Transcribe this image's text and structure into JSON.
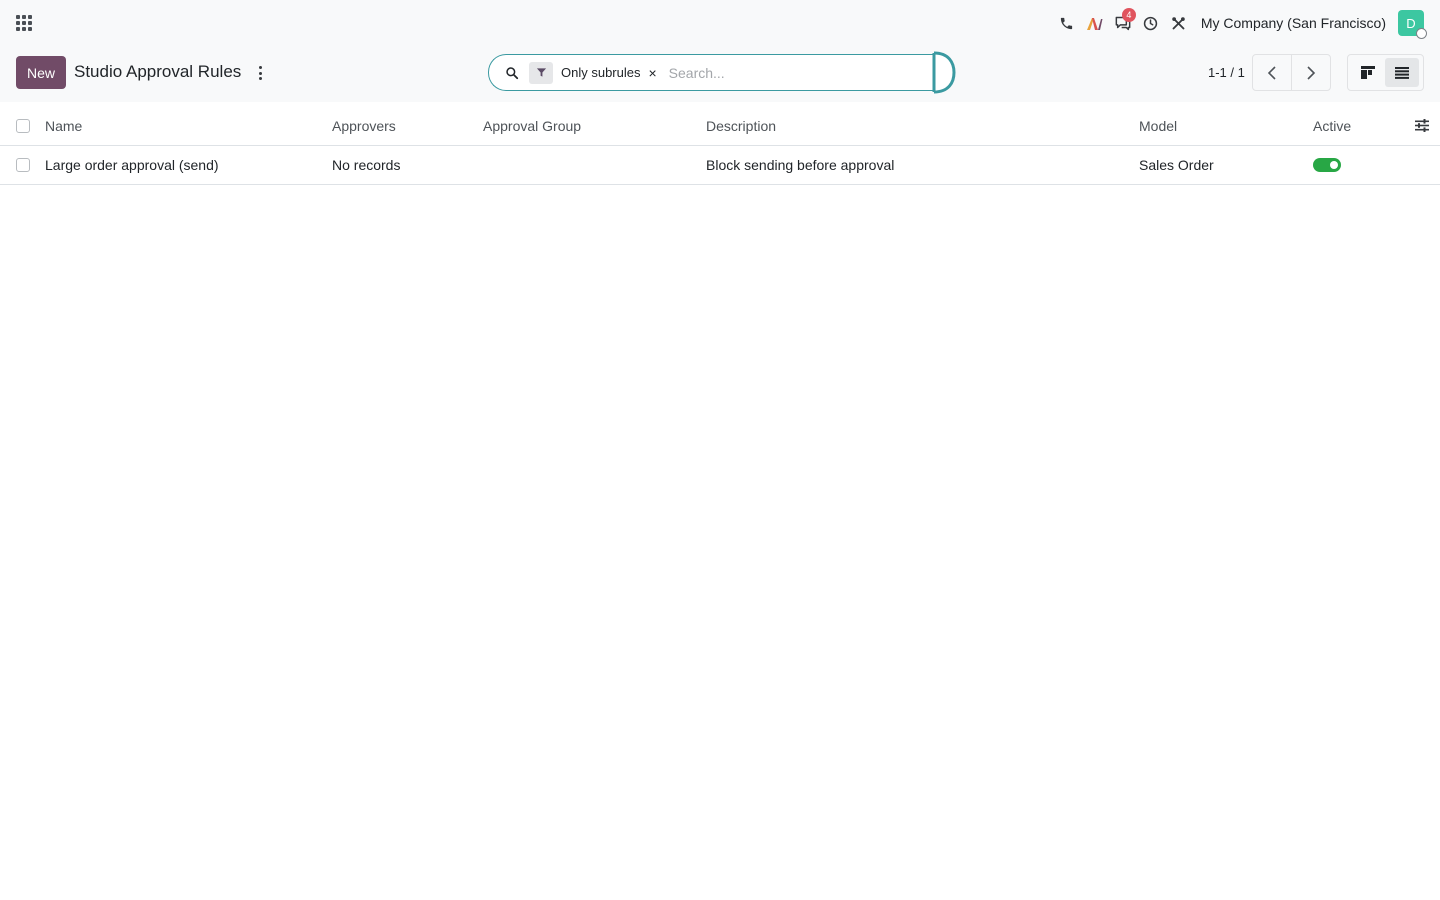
{
  "navbar": {
    "company": "My Company (San Francisco)",
    "messages_badge": "4",
    "avatar_initial": "D"
  },
  "control_panel": {
    "new_label": "New",
    "title": "Studio Approval Rules",
    "search": {
      "facet_label": "Only subrules",
      "facet_remove": "×",
      "placeholder": "Search..."
    },
    "pager": "1-1 / 1"
  },
  "table": {
    "columns": [
      "Name",
      "Approvers",
      "Approval Group",
      "Description",
      "Model",
      "Active"
    ],
    "rows": [
      {
        "name": "Large order approval (send)",
        "approvers": "No records",
        "approval_group": "",
        "description": "Block sending before approval",
        "model": "Sales Order",
        "active": true
      }
    ]
  },
  "colors": {
    "brand": "#714b67",
    "search_focus": "#3b9aa1",
    "toggle_on": "#28a745",
    "badge": "#e0545e",
    "avatar": "#3cc7a1"
  },
  "icons": [
    "apps-grid-icon",
    "phone-icon",
    "ai-icon",
    "chat-icon",
    "clock-icon",
    "tools-icon",
    "search-icon",
    "filter-icon",
    "chevron-left-icon",
    "chevron-right-icon",
    "kanban-view-icon",
    "list-view-icon",
    "optional-columns-icon"
  ]
}
